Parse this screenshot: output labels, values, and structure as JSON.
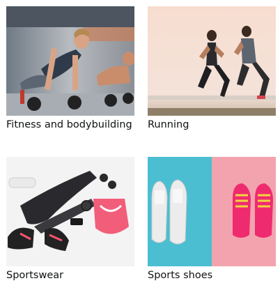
{
  "categories": [
    {
      "label": "Fitness and bodybuilding",
      "image_icon": "fitness-photo"
    },
    {
      "label": "Running",
      "image_icon": "running-photo"
    },
    {
      "label": "Sportswear",
      "image_icon": "sportswear-photo"
    },
    {
      "label": "Sports shoes",
      "image_icon": "sports-shoes-photo"
    }
  ],
  "colors": {
    "text": "#0f1111",
    "teal": "#4bbed2",
    "pink": "#f2a3ae",
    "shoe_pink": "#ef2b6f"
  }
}
